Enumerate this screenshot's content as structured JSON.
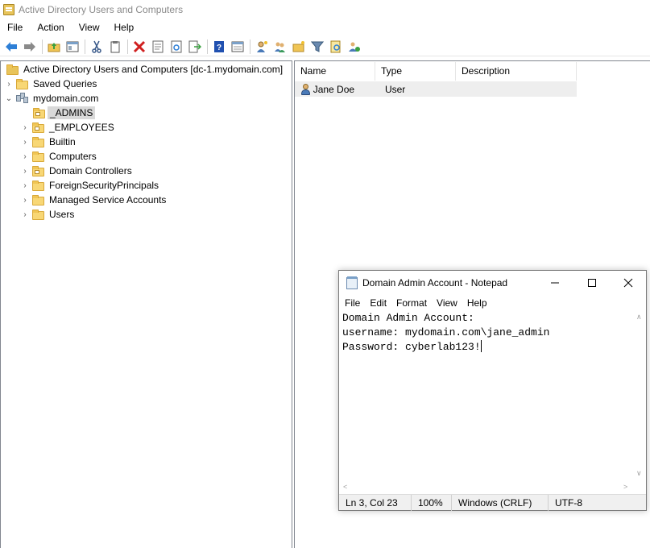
{
  "window": {
    "title": "Active Directory Users and Computers"
  },
  "menu": [
    "File",
    "Action",
    "View",
    "Help"
  ],
  "toolbar": {
    "buttons": [
      "back-icon",
      "forward-icon",
      "up-folder-icon",
      "show-hide-tree-icon",
      "cut-icon",
      "copy-icon",
      "delete-icon",
      "properties-icon",
      "refresh-icon",
      "export-list-icon",
      "help-icon",
      "console-view-icon",
      "new-user-icon",
      "new-group-icon",
      "new-ou-icon",
      "filter-icon",
      "find-icon",
      "add-to-group-icon"
    ]
  },
  "tree": {
    "root": "Active Directory Users and Computers [dc-1.mydomain.com]",
    "saved_queries": "Saved Queries",
    "domain": "mydomain.com",
    "children": [
      "_ADMINS",
      "_EMPLOYEES",
      "Builtin",
      "Computers",
      "Domain Controllers",
      "ForeignSecurityPrincipals",
      "Managed Service Accounts",
      "Users"
    ],
    "selected": "_ADMINS"
  },
  "list": {
    "columns": [
      "Name",
      "Type",
      "Description"
    ],
    "rows": [
      {
        "name": "Jane Doe",
        "type": "User",
        "description": ""
      }
    ]
  },
  "notepad": {
    "title": "Domain Admin Account - Notepad",
    "menu": [
      "File",
      "Edit",
      "Format",
      "View",
      "Help"
    ],
    "lines": [
      "Domain Admin Account:",
      "username: mydomain.com\\jane_admin",
      "Password: cyberlab123!"
    ],
    "status": {
      "position": "Ln 3, Col 23",
      "zoom": "100%",
      "line_endings": "Windows (CRLF)",
      "encoding": "UTF-8"
    }
  }
}
